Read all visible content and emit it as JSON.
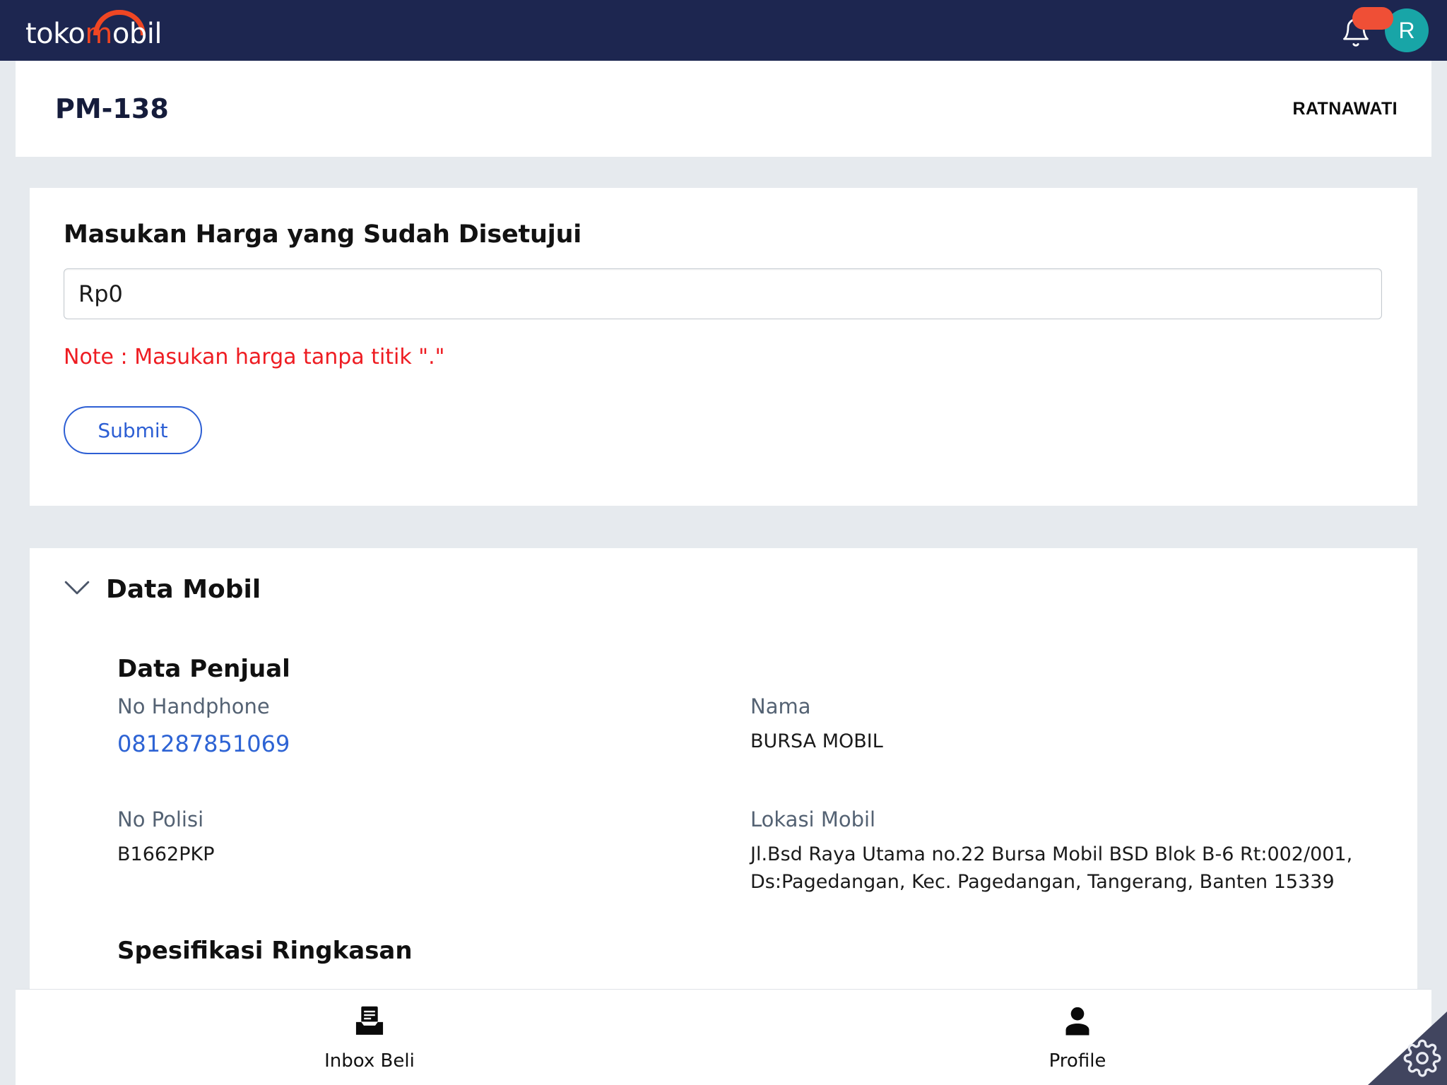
{
  "navbar": {
    "logo": {
      "text_before": "toko",
      "text_m": "m",
      "text_after": "obil",
      "icon": "logo-arc"
    },
    "bell": {
      "icon": "bell-icon",
      "badge_text": ""
    },
    "avatar": {
      "initial": "R",
      "color": "#18a5a7"
    }
  },
  "header": {
    "title": "PM-138",
    "user": "RATNAWATI"
  },
  "price_form": {
    "title": "Masukan Harga yang Sudah Disetujui",
    "input_value": "Rp0",
    "input_placeholder": "Rp0",
    "note": "Note : Masukan harga tanpa titik \".\"",
    "submit_label": "Submit",
    "note_color": "#ee1c22",
    "accent_color": "#2d5fd4"
  },
  "data_mobil": {
    "section_title": "Data Mobil",
    "chevron_icon": "chevron-down-icon",
    "penjual": {
      "title": "Data Penjual",
      "fields": [
        {
          "label": "No Handphone",
          "value": "081287851069",
          "is_link": true
        },
        {
          "label": "Nama",
          "value": "BURSA MOBIL",
          "is_link": false
        },
        {
          "label": "No Polisi",
          "value": "B1662PKP",
          "is_link": false
        },
        {
          "label": "Lokasi Mobil",
          "value": "Jl.Bsd Raya Utama no.22 Bursa Mobil BSD Blok B-6 Rt:002/001, Ds:Pagedangan, Kec. Pagedangan, Tangerang, Banten 15339",
          "is_link": false
        }
      ]
    },
    "spesifikasi_title": "Spesifikasi Ringkasan"
  },
  "bottom_nav": {
    "items": [
      {
        "label": "Inbox Beli",
        "icon": "inbox-icon"
      },
      {
        "label": "Profile",
        "icon": "person-icon"
      }
    ]
  },
  "corner_widget": {
    "icon": "gear-icon"
  }
}
